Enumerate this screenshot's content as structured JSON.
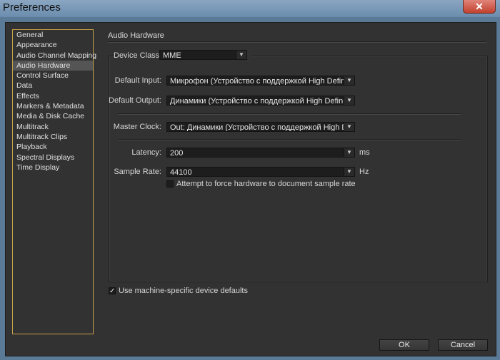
{
  "window": {
    "title": "Preferences",
    "close_glyph": "✕"
  },
  "sidebar": {
    "items": [
      "General",
      "Appearance",
      "Audio Channel Mapping",
      "Audio Hardware",
      "Control Surface",
      "Data",
      "Effects",
      "Markers & Metadata",
      "Media & Disk Cache",
      "Multitrack",
      "Multitrack Clips",
      "Playback",
      "Spectral Displays",
      "Time Display"
    ],
    "selected": "Audio Hardware"
  },
  "panel": {
    "title": "Audio Hardware",
    "device_class": {
      "label": "Device Class:",
      "value": "MME"
    },
    "default_input": {
      "label": "Default Input:",
      "value": "Микрофон (Устройство с поддержкой High Definiti..."
    },
    "default_output": {
      "label": "Default Output:",
      "value": "Динамики (Устройство с поддержкой High Definitio..."
    },
    "master_clock": {
      "label": "Master Clock:",
      "value": "Out: Динамики (Устройство с поддержкой High Def..."
    },
    "latency": {
      "label": "Latency:",
      "value": "200",
      "unit": "ms"
    },
    "sample_rate": {
      "label": "Sample Rate:",
      "value": "44100",
      "unit": "Hz"
    },
    "force_rate": {
      "label": "Attempt to force hardware to document sample rate",
      "checked": false
    },
    "machine_defaults": {
      "label": "Use machine-specific device defaults",
      "checked": true,
      "check_glyph": "✓"
    }
  },
  "buttons": {
    "ok": "OK",
    "cancel": "Cancel"
  },
  "icons": {
    "dropdown": "▼"
  }
}
